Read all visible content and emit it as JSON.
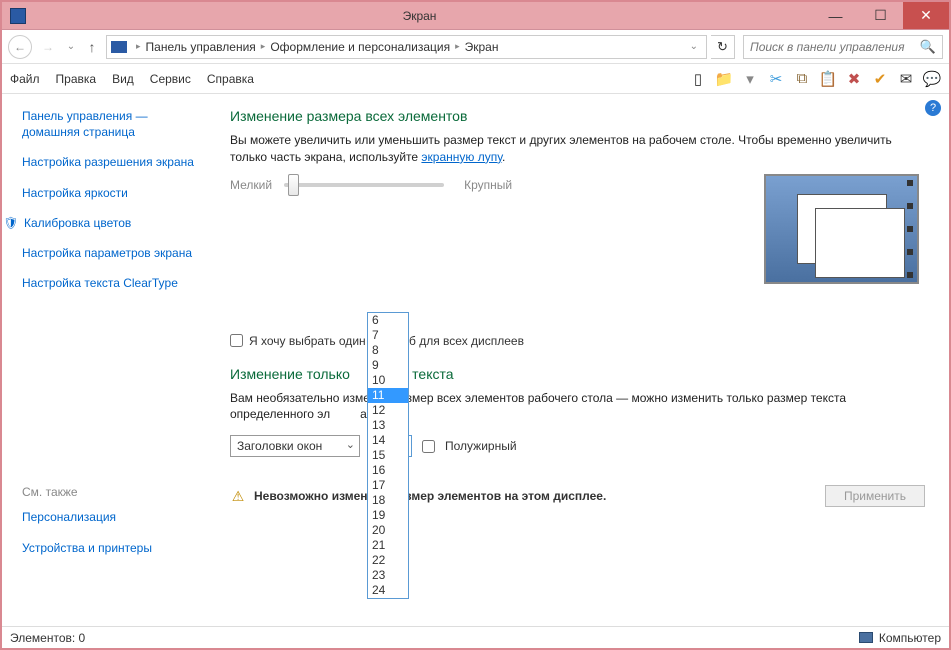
{
  "titlebar": {
    "title": "Экран"
  },
  "breadcrumb": {
    "segments": [
      "Панель управления",
      "Оформление и персонализация",
      "Экран"
    ]
  },
  "search": {
    "placeholder": "Поиск в панели управления"
  },
  "menus": {
    "file": "Файл",
    "edit": "Правка",
    "view": "Вид",
    "service": "Сервис",
    "help": "Справка"
  },
  "sidebar": {
    "home": "Панель управления — домашняя страница",
    "resolution": "Настройка разрешения экрана",
    "brightness": "Настройка яркости",
    "calibration": "Калибровка цветов",
    "display_params": "Настройка параметров экрана",
    "cleartype": "Настройка текста ClearType",
    "see_also": "См. также",
    "personalization": "Персонализация",
    "devices": "Устройства и принтеры"
  },
  "main": {
    "heading1": "Изменение размера всех элементов",
    "para1_a": "Вы можете увеличить или уменьшить размер текст и других элементов на рабочем столе. Чтобы временно увеличить только часть экрана, используйте ",
    "para1_link": "экранную лупу",
    "slider_min": "Мелкий",
    "slider_max": "Крупный",
    "checkbox1": "Я хочу выбрать один",
    "checkbox1_rest": "аб для всех дисплеев",
    "heading2_a": "Изменение только",
    "heading2_b": "ера текста",
    "para2_a": "Вам необязательно изме",
    "para2_b": "азмер всех элементов рабочего стола — можно изменить только размер текста определенного эл",
    "para2_c": "а.",
    "select1": "Заголовки окон",
    "select2": "11",
    "bold_check": "Полужирный",
    "warning": "Невозможно изменить размер элементов на этом дисплее.",
    "apply": "Применить"
  },
  "dropdown": {
    "items": [
      "6",
      "7",
      "8",
      "9",
      "10",
      "11",
      "12",
      "13",
      "14",
      "15",
      "16",
      "17",
      "18",
      "19",
      "20",
      "21",
      "22",
      "23",
      "24"
    ],
    "selected": "11"
  },
  "statusbar": {
    "elements": "Элементов: 0",
    "computer": "Компьютер"
  }
}
